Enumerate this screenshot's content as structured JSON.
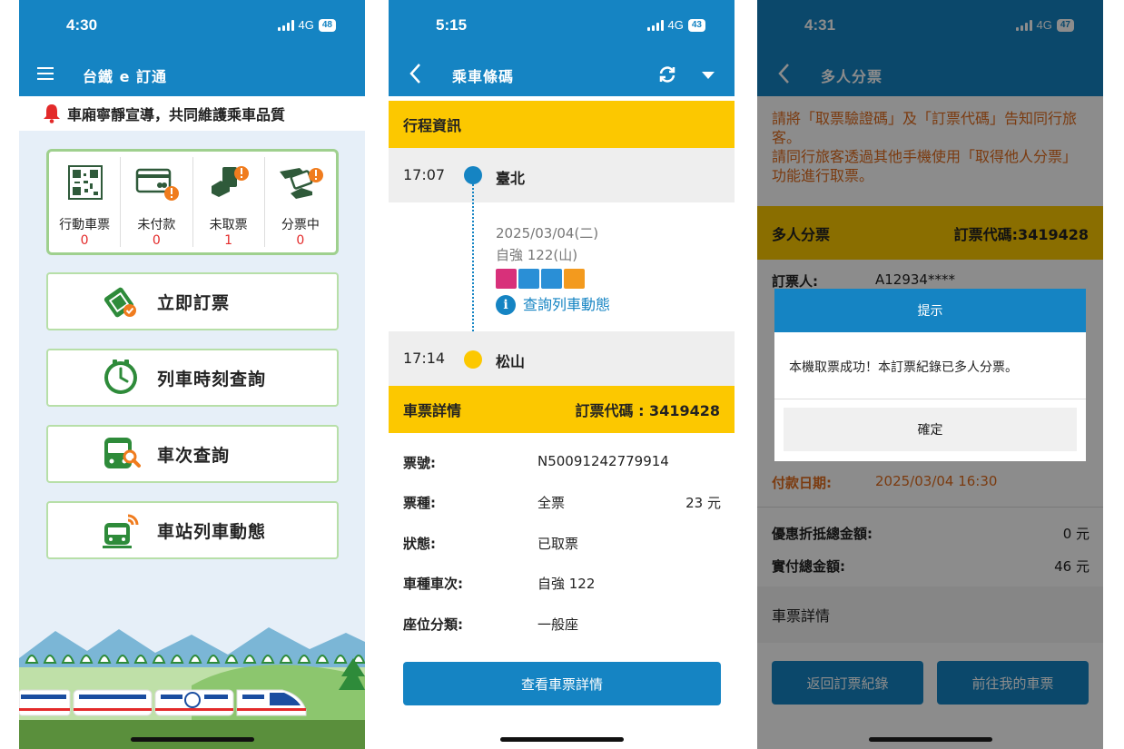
{
  "screen1": {
    "status": {
      "time": "4:30",
      "network": "4G",
      "battery": "48"
    },
    "nav_title": "台鐵 e 訂通",
    "banner_text": "車廂寧靜宣導，共同維護乘車品質",
    "quick": [
      {
        "icon": "qr-code-icon",
        "label": "行動車票",
        "count": "0"
      },
      {
        "icon": "credit-card-alert-icon",
        "label": "未付款",
        "count": "0"
      },
      {
        "icon": "ticket-hand-alert-icon",
        "label": "未取票",
        "count": "1"
      },
      {
        "icon": "ticket-share-alert-icon",
        "label": "分票中",
        "count": "0"
      }
    ],
    "buttons": [
      {
        "icon": "ticket-icon",
        "label": "立即訂票"
      },
      {
        "icon": "clock-icon",
        "label": "列車時刻查詢"
      },
      {
        "icon": "train-search-icon",
        "label": "車次查詢"
      },
      {
        "icon": "train-live-icon",
        "label": "車站列車動態"
      }
    ]
  },
  "screen2": {
    "status": {
      "time": "5:15",
      "network": "4G",
      "battery": "43"
    },
    "nav_title": "乘車條碼",
    "trip_header": "行程資訊",
    "departure": {
      "time": "17:07",
      "station": "臺北"
    },
    "date": "2025/03/04(二)",
    "train": "自強 122(山)",
    "query_link": "查詢列車動態",
    "arrival": {
      "time": "17:14",
      "station": "松山"
    },
    "ticket_header": "車票詳情",
    "booking_code": "訂票代碼 : 3419428",
    "details": {
      "ticket_no": {
        "label": "票號:",
        "value": "N50091242779914"
      },
      "ticket_type": {
        "label": "票種:",
        "value": "全票",
        "price": "23 元"
      },
      "status": {
        "label": "狀態:",
        "value": "已取票"
      },
      "train_no": {
        "label": "車種車次:",
        "value": "自強 122"
      },
      "seat_class": {
        "label": "座位分類:",
        "value": "一般座"
      }
    },
    "view_button": "查看車票詳情"
  },
  "screen3": {
    "status": {
      "time": "4:31",
      "network": "4G",
      "battery": "47"
    },
    "nav_title": "多人分票",
    "note": "請將「取票驗證碼」及「訂票代碼」告知同行旅客。\n請同行旅客透過其他手機使用「取得他人分票」功能進行取票。",
    "header_left": "多人分票",
    "header_right": "訂票代碼:3419428",
    "booker": {
      "label": "訂票人:",
      "value": "A12934****"
    },
    "pay_date": {
      "label": "付款日期:",
      "value": "2025/03/04 16:30"
    },
    "discount": {
      "label": "優惠折抵總金額:",
      "value": "0 元"
    },
    "paid": {
      "label": "實付總金額:",
      "value": "46 元"
    },
    "detail_title": "車票詳情",
    "back_button": "返回訂票紀錄",
    "mytickets_button": "前往我的車票",
    "dialog": {
      "title": "提示",
      "message": "本機取票成功！本訂票紀錄已多人分票。",
      "ok": "確定"
    }
  },
  "colors": {
    "primary": "#1584c3",
    "accent_yellow": "#fcc800",
    "alert_orange": "#f07c1e",
    "green": "#2e8b3a"
  }
}
